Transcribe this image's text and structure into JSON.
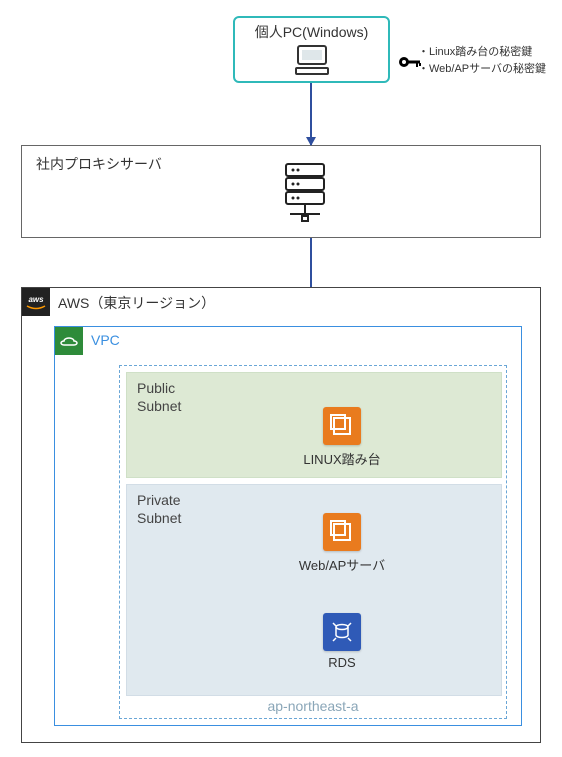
{
  "pc": {
    "title": "個人PC(Windows)"
  },
  "key_notes": {
    "line1": "・Linux踏み台の秘密鍵",
    "line2": "・Web/APサーバの秘密鍵"
  },
  "proxy": {
    "title": "社内プロキシサーバ"
  },
  "aws": {
    "title": "AWS（東京リージョン）",
    "logo_text": "aws"
  },
  "vpc": {
    "title": "VPC"
  },
  "az": {
    "label": "ap-northeast-a"
  },
  "subnets": {
    "public": {
      "title_l1": "Public",
      "title_l2": "Subnet"
    },
    "private": {
      "title_l1": "Private",
      "title_l2": "Subnet"
    }
  },
  "services": {
    "bastion": {
      "label": "LINUX踏み台"
    },
    "webap": {
      "label": "Web/APサーバ"
    },
    "rds": {
      "label": "RDS"
    }
  }
}
